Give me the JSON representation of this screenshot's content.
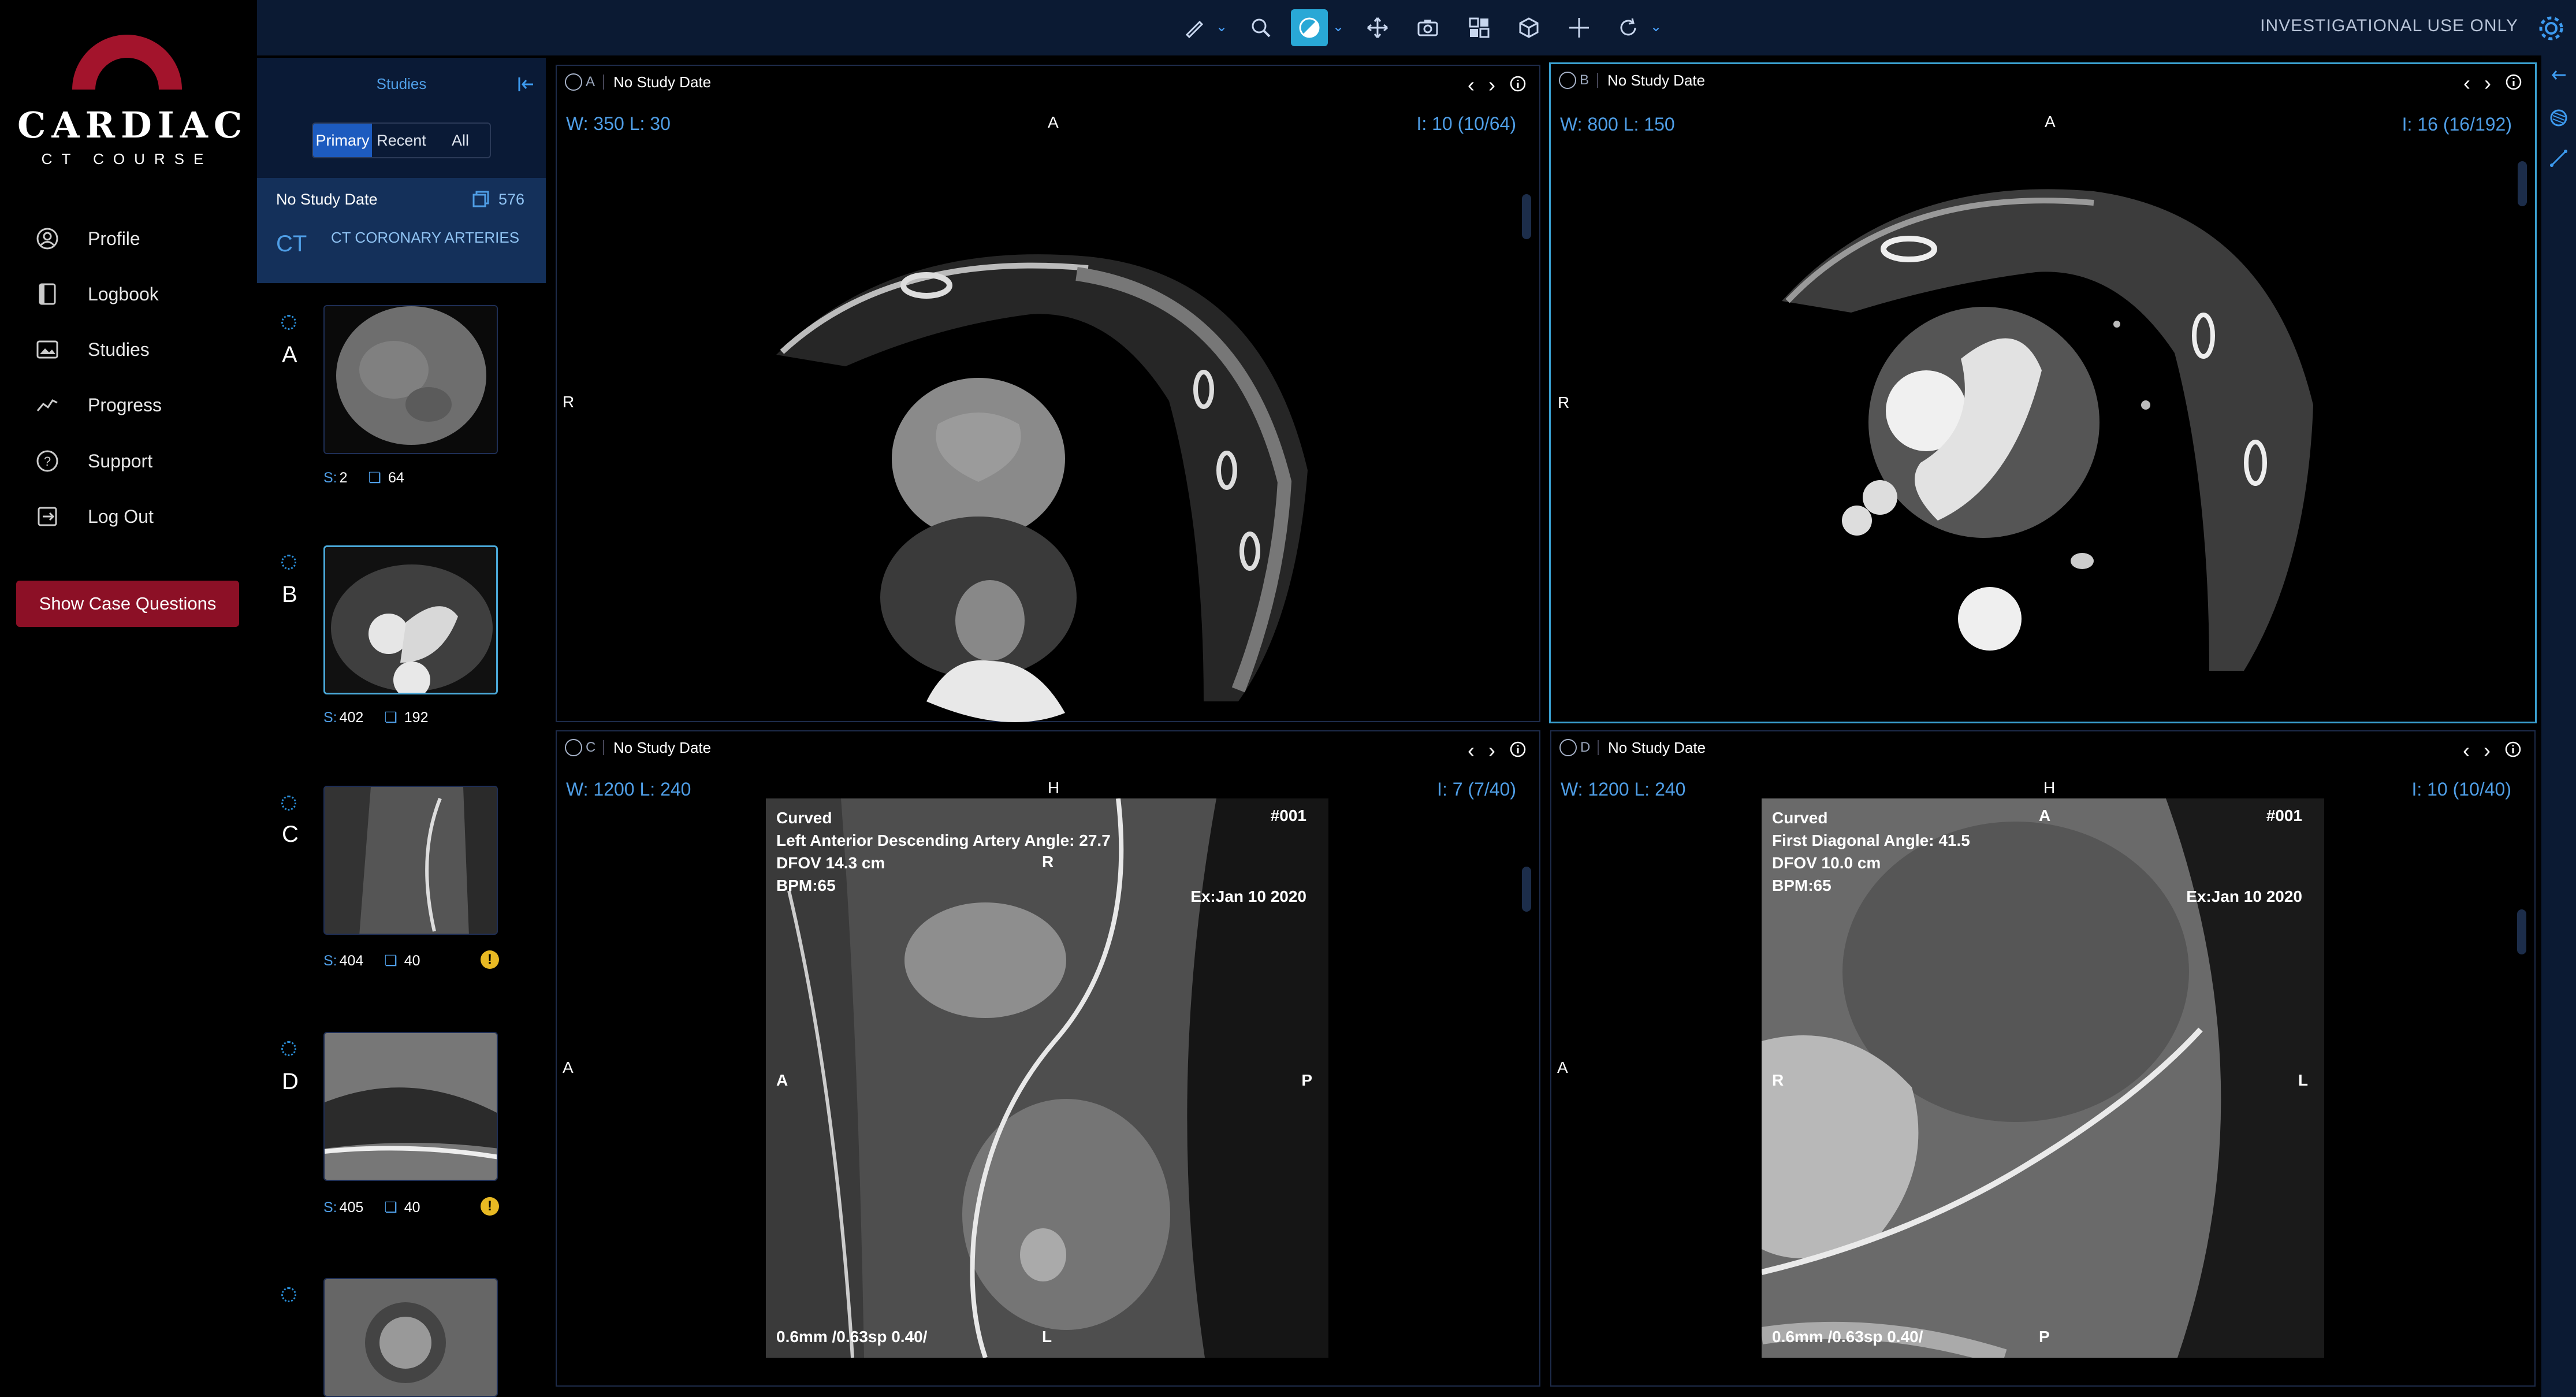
{
  "logo": {
    "title": "CARDIAC",
    "subtitle": "CT COURSE"
  },
  "nav": {
    "items": [
      {
        "label": "Profile",
        "icon": "profile-icon"
      },
      {
        "label": "Logbook",
        "icon": "logbook-icon"
      },
      {
        "label": "Studies",
        "icon": "studies-icon"
      },
      {
        "label": "Progress",
        "icon": "progress-icon"
      },
      {
        "label": "Support",
        "icon": "support-icon"
      },
      {
        "label": "Log Out",
        "icon": "logout-icon"
      }
    ],
    "show_case_button": "Show Case Questions"
  },
  "toolbar": {
    "tools": [
      "measure-icon",
      "zoom-icon",
      "window-level-icon",
      "pan-icon",
      "capture-icon",
      "layout-icon",
      "3d-icon",
      "crosshair-icon",
      "reset-icon"
    ],
    "active_tool": "window-level-icon",
    "investigational": "INVESTIGATIONAL USE ONLY"
  },
  "studies_panel": {
    "title": "Studies",
    "tabs": [
      "Primary",
      "Recent",
      "All"
    ],
    "active_tab": "Primary",
    "study": {
      "date": "No Study Date",
      "count": "576",
      "modality": "CT",
      "description": "CT CORONARY ARTERIES"
    },
    "series": [
      {
        "letter": "A",
        "s": "2",
        "n": "64",
        "warn": false
      },
      {
        "letter": "B",
        "s": "402",
        "n": "192",
        "warn": false
      },
      {
        "letter": "C",
        "s": "404",
        "n": "40",
        "warn": true
      },
      {
        "letter": "D",
        "s": "405",
        "n": "40",
        "warn": true
      },
      {
        "letter": "",
        "s": "",
        "n": "",
        "warn": false
      }
    ],
    "s_prefix": "S:",
    "warn_symbol": "!"
  },
  "viewports": [
    {
      "id": "A",
      "date": "No Study Date",
      "wl": "W: 350  L: 30",
      "index": "I: 10 (10/64)",
      "top": "A",
      "left": "R",
      "active": false
    },
    {
      "id": "B",
      "date": "No Study Date",
      "wl": "W: 800  L: 150",
      "index": "I: 16 (16/192)",
      "top": "A",
      "left": "R",
      "active": true
    },
    {
      "id": "C",
      "date": "No Study Date",
      "wl": "W: 1200  L: 240",
      "index": "I: 7 (7/40)",
      "top": "H",
      "left": "A",
      "active": false,
      "image_text": {
        "line1": "Curved",
        "line2": "Left Anterior Descending Artery Angle: 27.7",
        "line3": "DFOV 14.3 cm",
        "line4": "BPM:65",
        "id": "#001",
        "ex": "Ex:Jan 10 2020",
        "bottom": "0.6mm /0.63sp 0.40/",
        "o_top": "R",
        "o_left": "A",
        "o_right": "P",
        "o_bottom": "L"
      }
    },
    {
      "id": "D",
      "date": "No Study Date",
      "wl": "W: 1200  L: 240",
      "index": "I: 10 (10/40)",
      "top": "H",
      "left": "A",
      "active": false,
      "image_text": {
        "line1": "Curved",
        "line2": "First Diagonal Angle: 41.5",
        "line3": "DFOV 10.0 cm",
        "line4": "BPM:65",
        "id": "#001",
        "ex": "Ex:Jan 10 2020",
        "bottom": "0.6mm /0.63sp 0.40/",
        "o_top": "A",
        "o_left": "R",
        "o_right": "L",
        "o_bottom": "P"
      }
    }
  ]
}
